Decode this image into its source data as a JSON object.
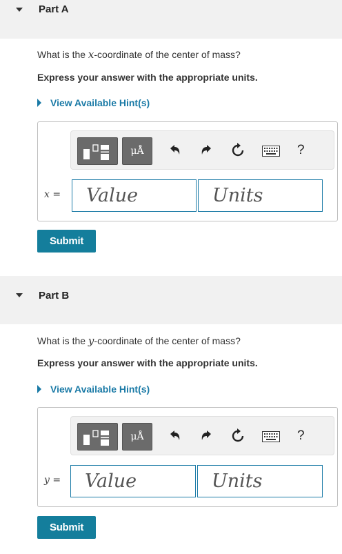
{
  "parts": [
    {
      "title": "Part A",
      "question_prefix": "What is the ",
      "question_var": "x",
      "question_suffix": "-coordinate of the center of mass?",
      "instruction": "Express your answer with the appropriate units.",
      "hint": "View Available Hint(s)",
      "equation_var": "x",
      "equation_eq": " =",
      "value_placeholder": "Value",
      "units_placeholder": "Units",
      "submit": "Submit"
    },
    {
      "title": "Part B",
      "question_prefix": "What is the ",
      "question_var": "y",
      "question_suffix": "-coordinate of the center of mass?",
      "instruction": "Express your answer with the appropriate units.",
      "hint": "View Available Hint(s)",
      "equation_var": "y",
      "equation_eq": " =",
      "value_placeholder": "Value",
      "units_placeholder": "Units",
      "submit": "Submit"
    }
  ],
  "toolbar": {
    "units_glyph": "μÅ",
    "help_label": "?",
    "icons": [
      "templates-icon",
      "units-icon",
      "undo-icon",
      "redo-icon",
      "reset-icon",
      "keyboard-icon",
      "help-icon"
    ]
  },
  "colors": {
    "accent": "#1a7aa6",
    "submit_bg": "#147e9c",
    "header_bg": "#f1f1f1",
    "toolbar_bg": "#f1f1f1",
    "tool_button_bg": "#6b6b6b"
  }
}
